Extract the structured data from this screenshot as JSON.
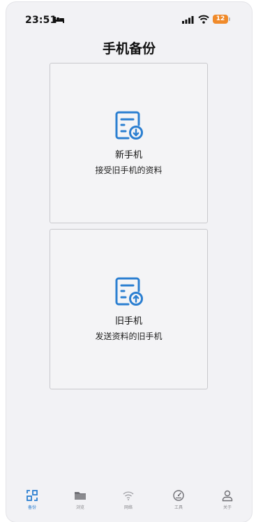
{
  "status_bar": {
    "time": "23:51",
    "battery": "12"
  },
  "header": {
    "title": "手机备份"
  },
  "cards": [
    {
      "title": "新手机",
      "subtitle": "接受旧手机的资料",
      "icon": "document-download-icon"
    },
    {
      "title": "旧手机",
      "subtitle": "发送资料的旧手机",
      "icon": "document-upload-icon"
    }
  ],
  "tab_bar": {
    "items": [
      {
        "label": "备份",
        "icon": "backup-icon",
        "active": true
      },
      {
        "label": "浏览",
        "icon": "folder-icon",
        "active": false
      },
      {
        "label": "网络",
        "icon": "wifi-icon",
        "active": false
      },
      {
        "label": "工具",
        "icon": "gauge-icon",
        "active": false
      },
      {
        "label": "关于",
        "icon": "person-icon",
        "active": false
      }
    ]
  },
  "colors": {
    "accent": "#2b7fd1",
    "battery": "#f08a2a",
    "background": "#f2f2f5"
  }
}
